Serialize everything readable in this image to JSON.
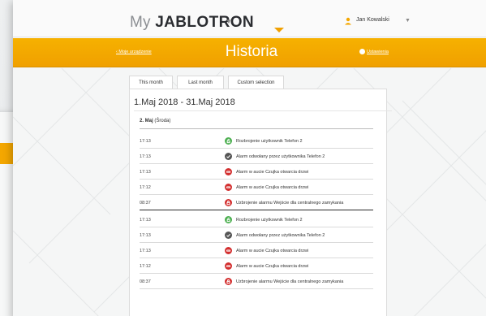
{
  "header": {
    "logo_my": "My",
    "logo_brand": "JABLOTRON",
    "logo_caret": "▼",
    "user_name": "Jan Kowalski",
    "user_caret": "▼",
    "user_icon": "user-icon"
  },
  "subheader": {
    "back_link": "‹ Moje urządzenie",
    "title": "Historia",
    "settings_link": "Ustawienia",
    "settings_icon": "gear-icon"
  },
  "tabs": [
    {
      "label": "This month",
      "active": true
    },
    {
      "label": "Last month",
      "active": false
    },
    {
      "label": "Custom selection",
      "active": false
    }
  ],
  "range": "1.Maj 2018 - 31.Maj 2018",
  "day": {
    "date": "2. Maj",
    "weekday": "(Środa)"
  },
  "events": [
    {
      "time": "17:13",
      "icon": "unlock-icon",
      "color": "#4caf50",
      "text": "Rozbrojenie użytkownik Telefon 2"
    },
    {
      "time": "17:13",
      "icon": "check-icon",
      "color": "#555555",
      "text": "Alarm odwołany przez użytkownika Telefon 2"
    },
    {
      "time": "17:13",
      "icon": "alarm-icon",
      "color": "#d32f2f",
      "text": "Alarm w aucie Czujka otwarcia drzwi"
    },
    {
      "time": "17:12",
      "icon": "alarm-icon",
      "color": "#d32f2f",
      "text": "Alarm w aucie Czujka otwarcia drzwi"
    },
    {
      "time": "08:37",
      "icon": "lock-icon",
      "color": "#d32f2f",
      "text": "Uzbrojenie alarmu Wejście dla centralnego zamykania"
    },
    {
      "time": "17:13",
      "icon": "unlock-icon",
      "color": "#4caf50",
      "text": "Rozbrojenie użytkownik Telefon 2"
    },
    {
      "time": "17:13",
      "icon": "check-icon",
      "color": "#555555",
      "text": "Alarm odwołany przez użytkownika Telefon 2"
    },
    {
      "time": "17:13",
      "icon": "alarm-icon",
      "color": "#d32f2f",
      "text": "Alarm w aucie Czujka otwarcia drzwi"
    },
    {
      "time": "17:12",
      "icon": "alarm-icon",
      "color": "#d32f2f",
      "text": "Alarm w aucie Czujka otwarcia drzwi"
    },
    {
      "time": "08:37",
      "icon": "lock-icon",
      "color": "#d32f2f",
      "text": "Uzbrojenie alarmu Wejście dla centralnego zamykania"
    }
  ],
  "colors": {
    "accent": "#f4a700",
    "green": "#4caf50",
    "red": "#d32f2f"
  }
}
